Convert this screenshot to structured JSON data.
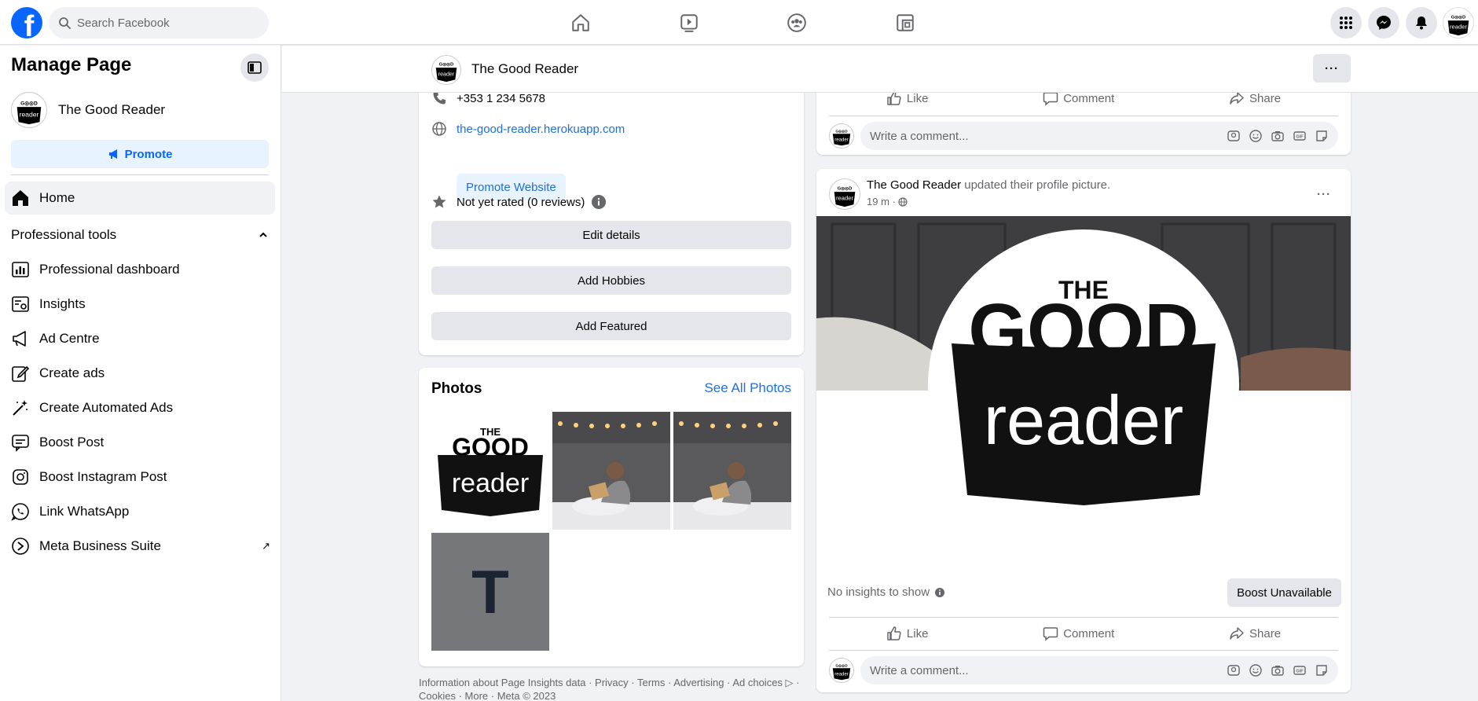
{
  "topbar": {
    "logo_letter": "f",
    "search_placeholder": "Search Facebook"
  },
  "sidebar": {
    "title": "Manage Page",
    "page_name": "The Good Reader",
    "promote_label": "Promote",
    "home_label": "Home",
    "section_label": "Professional tools",
    "items": [
      {
        "label": "Professional dashboard",
        "icon": "dashboard-icon"
      },
      {
        "label": "Insights",
        "icon": "insights-icon"
      },
      {
        "label": "Ad Centre",
        "icon": "megaphone-icon"
      },
      {
        "label": "Create ads",
        "icon": "pencil-icon"
      },
      {
        "label": "Create Automated Ads",
        "icon": "magic-wand-icon"
      },
      {
        "label": "Boost Post",
        "icon": "boost-icon"
      },
      {
        "label": "Boost Instagram Post",
        "icon": "instagram-icon"
      },
      {
        "label": "Link WhatsApp",
        "icon": "whatsapp-icon"
      },
      {
        "label": "Meta Business Suite",
        "icon": "meta-icon",
        "external": "↗"
      }
    ]
  },
  "page_header": {
    "name": "The Good Reader",
    "more_label": "···"
  },
  "intro": {
    "phone": "+353 1 234 5678",
    "website": "the-good-reader.herokuapp.com",
    "promote_website": "Promote Website",
    "rating": "Not yet rated (0 reviews)",
    "edit_details": "Edit details",
    "add_hobbies": "Add Hobbies",
    "add_featured": "Add Featured"
  },
  "photos": {
    "title": "Photos",
    "see_all": "See All Photos",
    "placeholder_letter": "T"
  },
  "footer": {
    "links": "Information about Page Insights data · Privacy · Terms · Advertising · Ad choices ▷ · Cookies · More · Meta © 2023"
  },
  "post_actions": {
    "like": "Like",
    "comment": "Comment",
    "share": "Share",
    "comment_placeholder": "Write a comment..."
  },
  "post": {
    "author": "The Good Reader",
    "action_text": " updated their profile picture.",
    "time": "19 m ·",
    "more_label": "···",
    "insights": "No insights to show",
    "boost_label": "Boost Unavailable"
  },
  "logo": {
    "the": "THE",
    "good": "GOOD",
    "reader": "reader"
  },
  "colors": {
    "brand": "#0866ff",
    "link": "#216fdb",
    "page_bg": "#f0f2f5"
  }
}
